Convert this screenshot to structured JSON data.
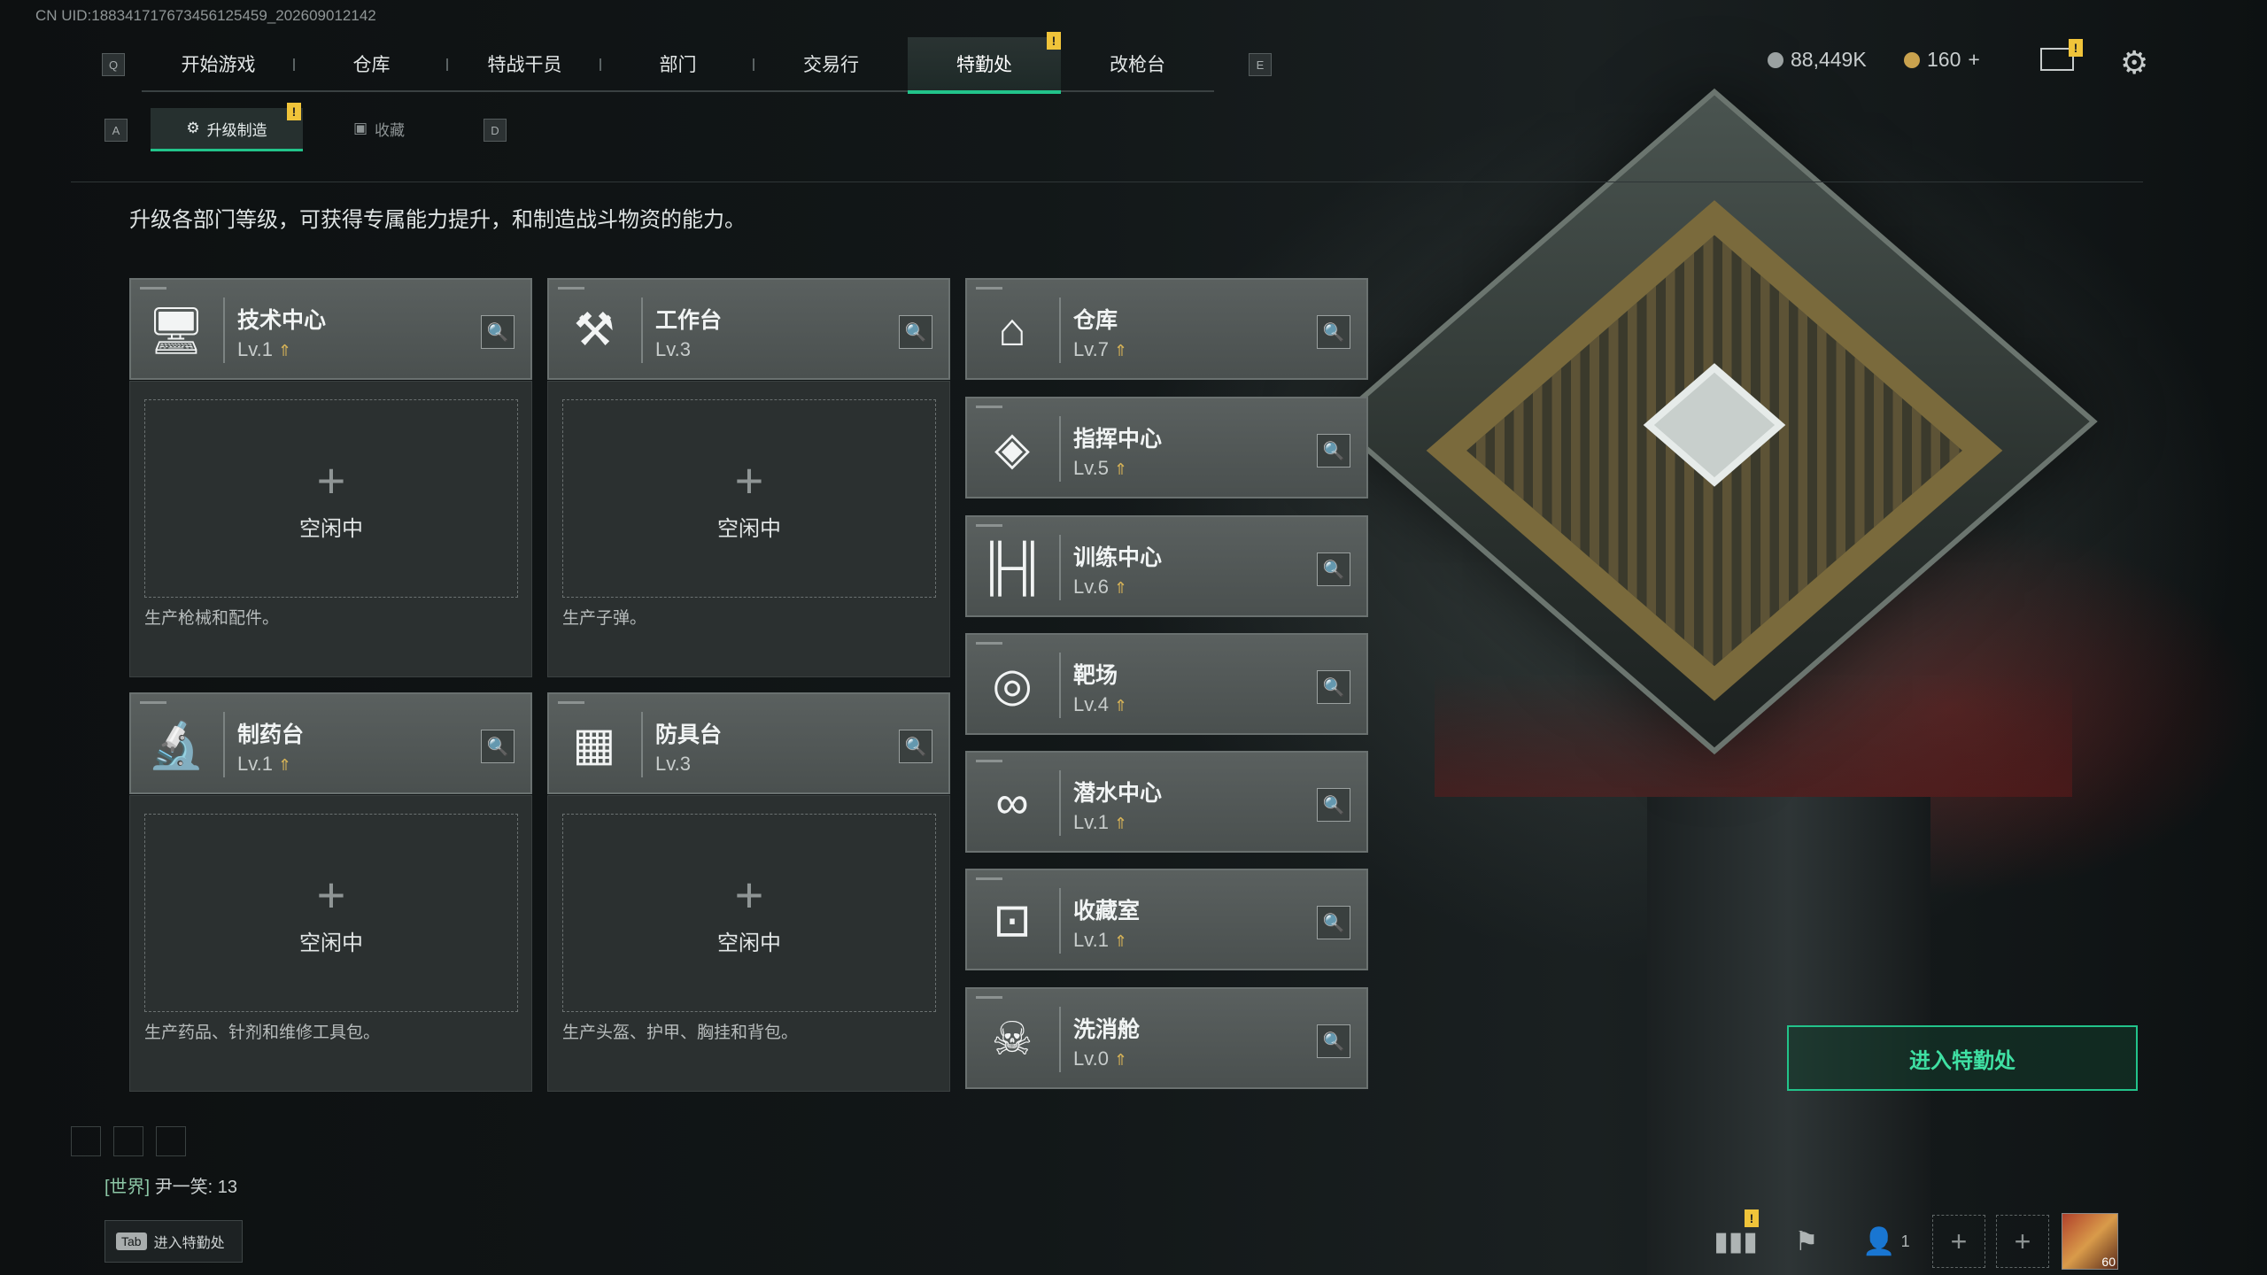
{
  "uid": "CN UID:1883417176734561254​59_202609012142",
  "top_nav": {
    "key_left": "Q",
    "key_right": "E",
    "tabs": [
      {
        "label": "开始游戏",
        "active": false
      },
      {
        "label": "仓库",
        "active": false
      },
      {
        "label": "特战干员",
        "active": false
      },
      {
        "label": "部门",
        "active": false
      },
      {
        "label": "交易行",
        "active": false
      },
      {
        "label": "特勤处",
        "active": true,
        "alert": "!"
      },
      {
        "label": "改枪台",
        "active": false
      }
    ]
  },
  "currency": {
    "coins": "88,449K",
    "premium": "160",
    "plus": "+"
  },
  "mail_alert": "!",
  "sub_nav": {
    "key_left": "A",
    "key_right": "D",
    "tabs": [
      {
        "label": "升级制造",
        "active": true,
        "alert": "!"
      },
      {
        "label": "收藏",
        "active": false
      }
    ]
  },
  "description": "升级各部门等级，可获得专属能力提升，和制造战斗物资的能力。",
  "production": [
    {
      "name": "技术中心",
      "level": "Lv.1",
      "icon": "computer-icon",
      "status": "空闲中",
      "desc": "生产枪械和配件。"
    },
    {
      "name": "工作台",
      "level": "Lv.3",
      "icon": "tools-icon",
      "status": "空闲中",
      "desc": "生产子弹。"
    },
    {
      "name": "制药台",
      "level": "Lv.1",
      "icon": "microscope-icon",
      "status": "空闲中",
      "desc": "生产药品、针剂和维修工具包。"
    },
    {
      "name": "防具台",
      "level": "Lv.3",
      "icon": "armor-blocks-icon",
      "status": "空闲中",
      "desc": "生产头盔、护甲、胸挂和背包。"
    }
  ],
  "departments": [
    {
      "name": "仓库",
      "level": "Lv.7",
      "icon": "warehouse-icon"
    },
    {
      "name": "指挥中心",
      "level": "Lv.5",
      "icon": "command-diamond-icon"
    },
    {
      "name": "训练中心",
      "level": "Lv.6",
      "icon": "dumbbell-icon"
    },
    {
      "name": "靶场",
      "level": "Lv.4",
      "icon": "target-icon"
    },
    {
      "name": "潜水中心",
      "level": "Lv.1",
      "icon": "diving-goggles-icon"
    },
    {
      "name": "收藏室",
      "level": "Lv.1",
      "icon": "display-case-icon"
    },
    {
      "name": "洗消舱",
      "level": "Lv.0",
      "icon": "decontamination-icon"
    }
  ],
  "enter_button": "进入特勤处",
  "chat": {
    "channel": "[世界]",
    "message": "尹一笑: 13"
  },
  "tab_hint": {
    "key": "Tab",
    "label": "进入特勤处"
  },
  "bottom": {
    "friends_count": "1",
    "avatar_level": "60",
    "stats_alert": "!"
  },
  "colors": {
    "accent": "#22c38a",
    "warning": "#f0c43a",
    "level_up_arrow": "#d8b457"
  }
}
